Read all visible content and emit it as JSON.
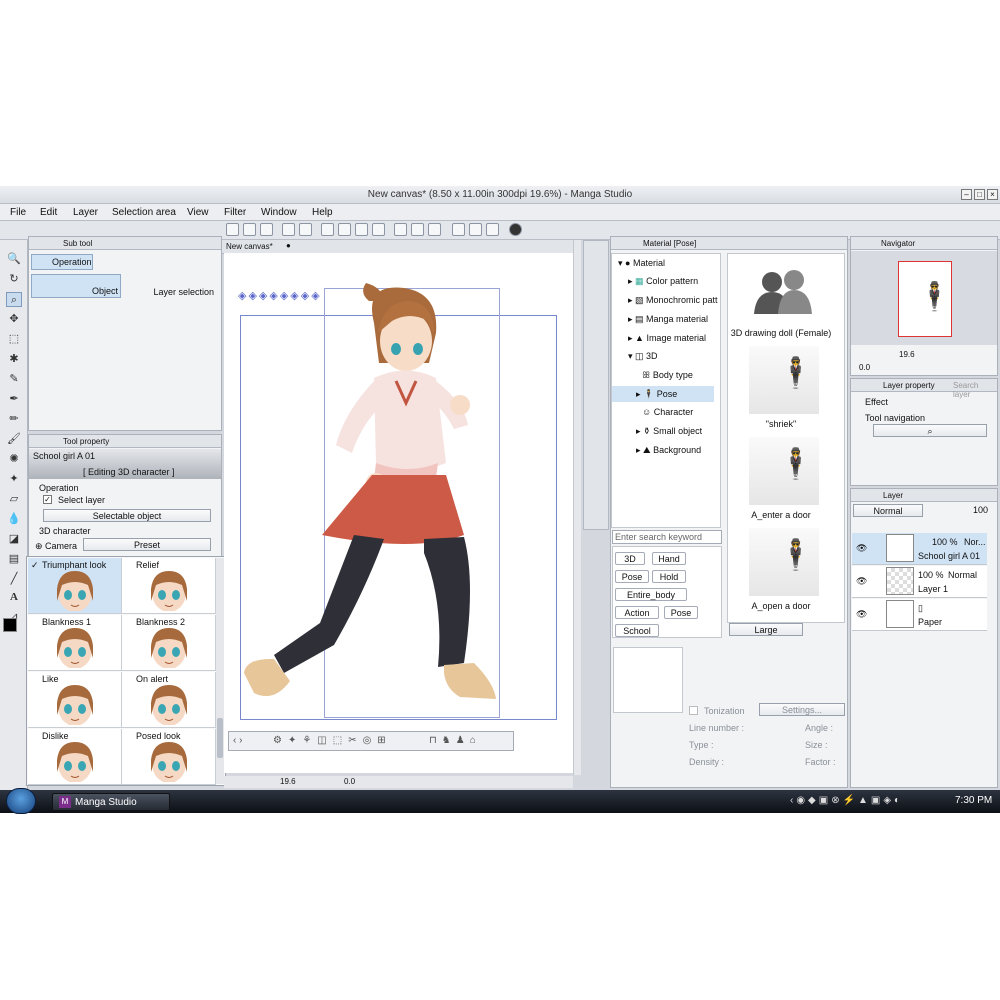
{
  "window": {
    "title": "New canvas* (8.50 x 11.00in 300dpi 19.6%) - Manga Studio"
  },
  "menu": [
    "File",
    "Edit",
    "Layer",
    "Selection area",
    "View",
    "Filter",
    "Window",
    "Help"
  ],
  "subtool": {
    "tab": "Sub tool",
    "group": "Operation",
    "items": [
      "Object",
      "Layer selection"
    ]
  },
  "tool_property": {
    "tab": "Tool property",
    "name": "School girl A 01",
    "mode": "[ Editing 3D character ]",
    "operation_label": "Operation",
    "select_layer": "Select layer",
    "selectable": "Selectable object",
    "character_label": "3D character",
    "camera": "Camera",
    "preset": "Preset"
  },
  "faces": [
    {
      "label": "Triumphant look",
      "checked": true
    },
    {
      "label": "Relief",
      "checked": false
    },
    {
      "label": "Blankness 1",
      "checked": false
    },
    {
      "label": "Blankness 2",
      "checked": false
    },
    {
      "label": "Like",
      "checked": false
    },
    {
      "label": "On alert",
      "checked": false
    },
    {
      "label": "Dislike",
      "checked": false
    },
    {
      "label": "Posed look",
      "checked": false
    }
  ],
  "canvas": {
    "tab": "New canvas*",
    "zoom": "19.6",
    "angle": "0.0"
  },
  "material": {
    "tab": "Material [Pose]",
    "tree": [
      {
        "label": "Material",
        "level": 0
      },
      {
        "label": "Color pattern",
        "level": 1
      },
      {
        "label": "Monochromic patt",
        "level": 1
      },
      {
        "label": "Manga material",
        "level": 1
      },
      {
        "label": "Image material",
        "level": 1
      },
      {
        "label": "3D",
        "level": 1
      },
      {
        "label": "Body type",
        "level": 2
      },
      {
        "label": "Pose",
        "level": 2
      },
      {
        "label": "Character",
        "level": 2
      },
      {
        "label": "Small object",
        "level": 2
      },
      {
        "label": "Background",
        "level": 2
      }
    ],
    "search_placeholder": "Enter search keyword",
    "keywords": [
      "3D",
      "Hand",
      "Pose",
      "Hold",
      "Entire_body",
      "Action",
      "Pose",
      "School"
    ],
    "thumbs": [
      "3D drawing doll (Female)",
      "\"shriek\"",
      "A_enter a door",
      "A_open a door"
    ],
    "size": "Large",
    "tonization": "Tonization",
    "settings": "Settings...",
    "props": [
      "Line number :",
      "Angle :",
      "Type :",
      "Size :",
      "Density :",
      "Factor :"
    ]
  },
  "navigator": {
    "tab": "Navigator",
    "zoom": "19.6",
    "angle": "0.0"
  },
  "layer_property": {
    "tab": "Layer property",
    "tab2": "Search layer",
    "effect": "Effect",
    "tool_nav": "Tool navigation"
  },
  "layers": {
    "tab": "Layer",
    "blend": "Normal",
    "opacity": "100",
    "items": [
      {
        "percent": "100 %",
        "mode": "Nor...",
        "name": "School girl A 01"
      },
      {
        "percent": "100 %",
        "mode": "Normal",
        "name": "Layer 1"
      },
      {
        "percent": "",
        "mode": "",
        "name": "Paper"
      }
    ]
  },
  "taskbar": {
    "app": "Manga Studio",
    "time": "7:30 PM"
  }
}
